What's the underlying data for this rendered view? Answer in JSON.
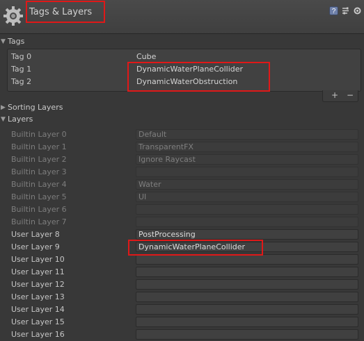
{
  "header": {
    "title": "Tags & Layers",
    "icons": [
      "gear-icon",
      "help-icon",
      "preset-icon",
      "settings-icon"
    ]
  },
  "tags": {
    "title": "Tags",
    "items": [
      {
        "name": "Tag 0",
        "value": "Cube"
      },
      {
        "name": "Tag 1",
        "value": "DynamicWaterPlaneCollider"
      },
      {
        "name": "Tag 2",
        "value": "DynamicWaterObstruction"
      }
    ],
    "add_label": "+",
    "remove_label": "−"
  },
  "sorting_layers": {
    "title": "Sorting Layers"
  },
  "layers": {
    "title": "Layers",
    "items": [
      {
        "name": "Builtin Layer 0",
        "value": "Default",
        "builtin": true
      },
      {
        "name": "Builtin Layer 1",
        "value": "TransparentFX",
        "builtin": true
      },
      {
        "name": "Builtin Layer 2",
        "value": "Ignore Raycast",
        "builtin": true
      },
      {
        "name": "Builtin Layer 3",
        "value": "",
        "builtin": true
      },
      {
        "name": "Builtin Layer 4",
        "value": "Water",
        "builtin": true
      },
      {
        "name": "Builtin Layer 5",
        "value": "UI",
        "builtin": true
      },
      {
        "name": "Builtin Layer 6",
        "value": "",
        "builtin": true
      },
      {
        "name": "Builtin Layer 7",
        "value": "",
        "builtin": true
      },
      {
        "name": "User Layer 8",
        "value": "PostProcessing",
        "builtin": false
      },
      {
        "name": "User Layer 9",
        "value": "DynamicWaterPlaneCollider",
        "builtin": false
      },
      {
        "name": "User Layer 10",
        "value": "",
        "builtin": false
      },
      {
        "name": "User Layer 11",
        "value": "",
        "builtin": false
      },
      {
        "name": "User Layer 12",
        "value": "",
        "builtin": false
      },
      {
        "name": "User Layer 13",
        "value": "",
        "builtin": false
      },
      {
        "name": "User Layer 14",
        "value": "",
        "builtin": false
      },
      {
        "name": "User Layer 15",
        "value": "",
        "builtin": false
      },
      {
        "name": "User Layer 16",
        "value": "",
        "builtin": false
      }
    ]
  },
  "colors": {
    "highlight": "#e01818",
    "background": "#383838"
  }
}
